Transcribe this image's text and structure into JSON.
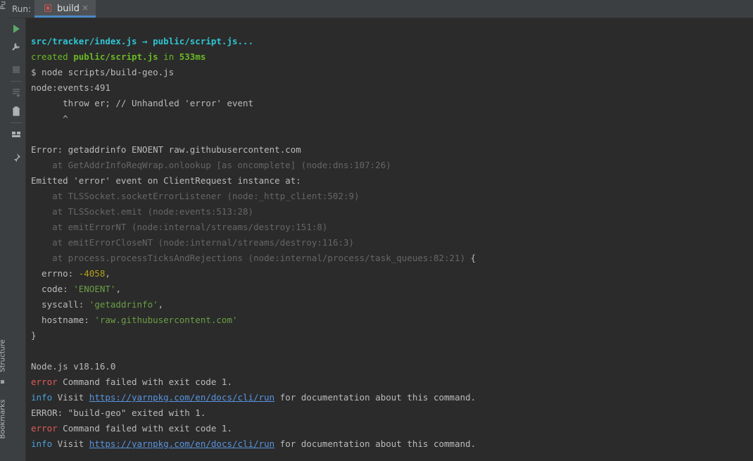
{
  "left_strip": {
    "top_label": "Pu",
    "structure_label": "Structure",
    "bookmarks_label": "Bookmarks"
  },
  "header": {
    "run_label": "Run:",
    "tab_label": "build",
    "tab_close": "×"
  },
  "toolbar": {
    "buttons": [
      "run-icon",
      "wrench-icon",
      "stop-icon",
      "scroll-to-end-icon",
      "trash-icon",
      "layout-icon",
      "pin-icon"
    ]
  },
  "colors": {
    "accent": "#4a88c7",
    "background": "#2b2b2b",
    "error": "#e35a5a",
    "info": "#4a9fdb",
    "link": "#5894e0"
  },
  "console": {
    "l1": {
      "a": "src/tracker/index.js",
      "b": " → ",
      "c": "public/script.js",
      "d": "..."
    },
    "l2": {
      "a": "created ",
      "b": "public/script.js",
      "c": " in ",
      "d": "533ms"
    },
    "l3": "$ node scripts/build-geo.js",
    "l4": "node:events:491",
    "l5": "      throw er; // Unhandled 'error' event",
    "l6": "      ^",
    "l7": "",
    "l8": "Error: getaddrinfo ENOENT raw.githubusercontent.com",
    "l9": "    at GetAddrInfoReqWrap.onlookup [as oncomplete] (node:dns:107:26)",
    "l10": "Emitted 'error' event on ClientRequest instance at:",
    "l11": "    at TLSSocket.socketErrorListener (node:_http_client:502:9)",
    "l12": "    at TLSSocket.emit (node:events:513:28)",
    "l13": "    at emitErrorNT (node:internal/streams/destroy:151:8)",
    "l14": "    at emitErrorCloseNT (node:internal/streams/destroy:116:3)",
    "l15": {
      "a": "    at process.processTicksAndRejections (node:internal/process/task_queues:82:21)",
      "b": " {"
    },
    "l16": {
      "a": "  errno: ",
      "b": "-4058",
      "c": ","
    },
    "l17": {
      "a": "  code: ",
      "b": "'ENOENT'",
      "c": ","
    },
    "l18": {
      "a": "  syscall: ",
      "b": "'getaddrinfo'",
      "c": ","
    },
    "l19": {
      "a": "  hostname: ",
      "b": "'raw.githubusercontent.com'"
    },
    "l20": "}",
    "l21": "",
    "l22": "Node.js v18.16.0",
    "l23": {
      "a": "error",
      "b": " Command failed with exit code 1."
    },
    "l24": {
      "a": "info",
      "b": " Visit ",
      "c": "https://yarnpkg.com/en/docs/cli/run",
      "d": " for documentation about this command."
    },
    "l25": "ERROR: \"build-geo\" exited with 1.",
    "l26": {
      "a": "error",
      "b": " Command failed with exit code 1."
    },
    "l27": {
      "a": "info",
      "b": " Visit ",
      "c": "https://yarnpkg.com/en/docs/cli/run",
      "d": " for documentation about this command."
    }
  }
}
